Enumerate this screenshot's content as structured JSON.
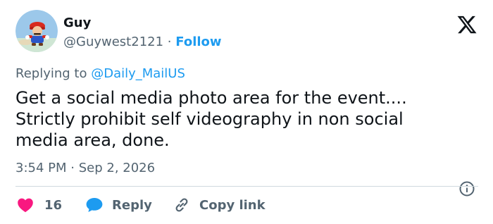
{
  "user": {
    "name": "Guy",
    "handle": "@Guywest2121",
    "separator": "·",
    "follow_label": "Follow",
    "avatar_icon": "mario-avatar-icon"
  },
  "brand": {
    "logo_icon": "x-logo-icon"
  },
  "reply_context": {
    "prefix": "Replying to ",
    "mention": "@Daily_MailUS"
  },
  "tweet": {
    "lines": [
      "Get a social media photo area for the event....",
      "Strictly prohibit self videography in non social",
      "media area, done."
    ]
  },
  "timestamp": {
    "time": "3:54 PM",
    "separator": "·",
    "date": "Sep 2, 2026"
  },
  "actions": {
    "like_count": "16",
    "reply_label": "Reply",
    "copy_link_label": "Copy link"
  },
  "colors": {
    "accent": "#1d9bf0",
    "like": "#f91880",
    "text": "#0f1419",
    "muted": "#536471",
    "divider": "#cfd9de"
  }
}
